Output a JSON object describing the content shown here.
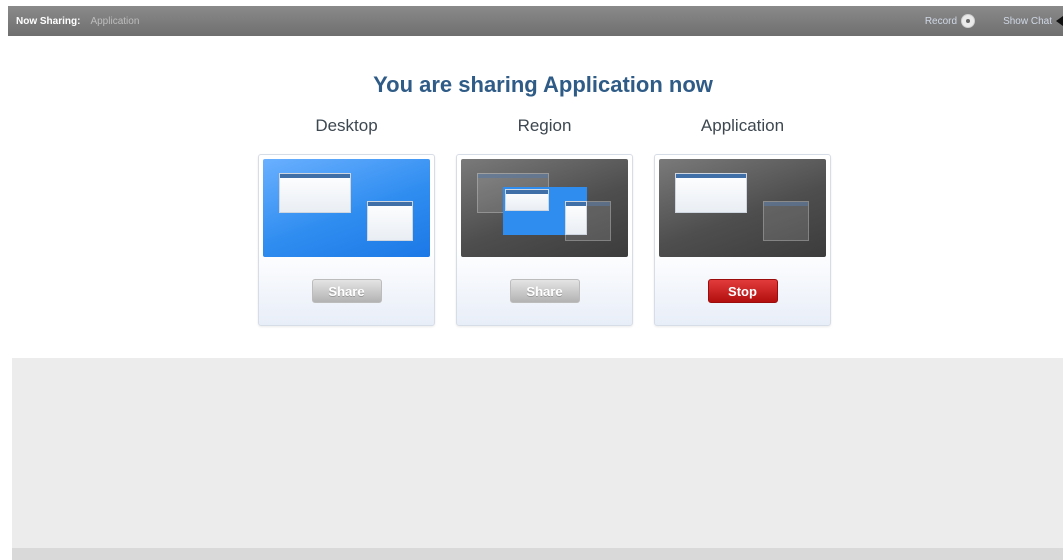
{
  "topbar": {
    "now_sharing_label": "Now Sharing:",
    "now_sharing_value": "Application",
    "record_label": "Record",
    "show_chat_label": "Show Chat"
  },
  "heading": "You are sharing Application now",
  "options": [
    {
      "title": "Desktop",
      "button_label": "Share",
      "button_state": "disabled"
    },
    {
      "title": "Region",
      "button_label": "Share",
      "button_state": "disabled"
    },
    {
      "title": "Application",
      "button_label": "Stop",
      "button_state": "active"
    }
  ],
  "colors": {
    "topbar": "#7c7c7c",
    "heading": "#2f5b87",
    "desktop_preview": "#2f8df0",
    "stop_button": "#c51a1a"
  },
  "icons": {
    "record": "record-icon",
    "show_chat": "triangle-left-icon"
  }
}
